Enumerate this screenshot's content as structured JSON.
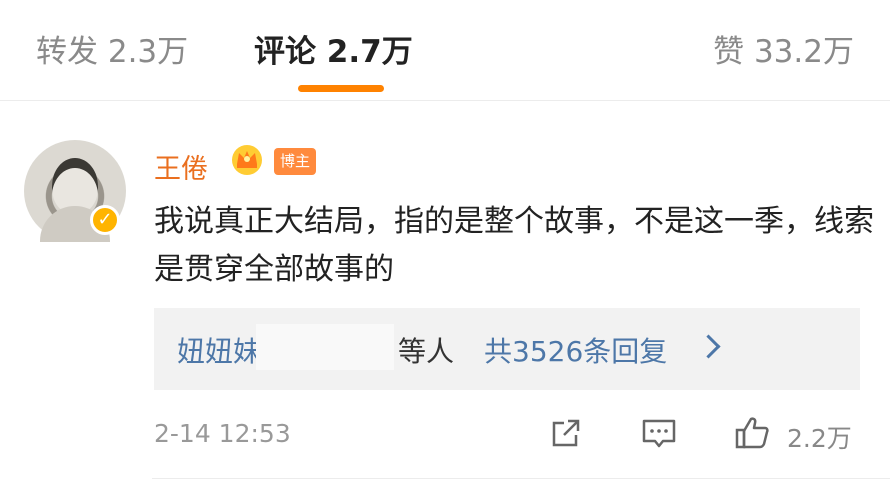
{
  "tabs": {
    "repost": "转发 2.3万",
    "comments": "评论 2.7万",
    "likes": "赞 33.2万"
  },
  "comment": {
    "username": "王倦",
    "author_badge": "博主",
    "text": "我说真正大结局，指的是整个故事，不是这一季，线索是贯穿全部故事的",
    "replies": {
      "names": "妞妞妹",
      "suffix": "等人",
      "total": "共3526条回复"
    },
    "timestamp": "2-14 12:53",
    "like_count": "2.2万"
  },
  "colors": {
    "accent": "#ff8200",
    "username": "#ea6f1f",
    "link": "#4d77a8"
  }
}
